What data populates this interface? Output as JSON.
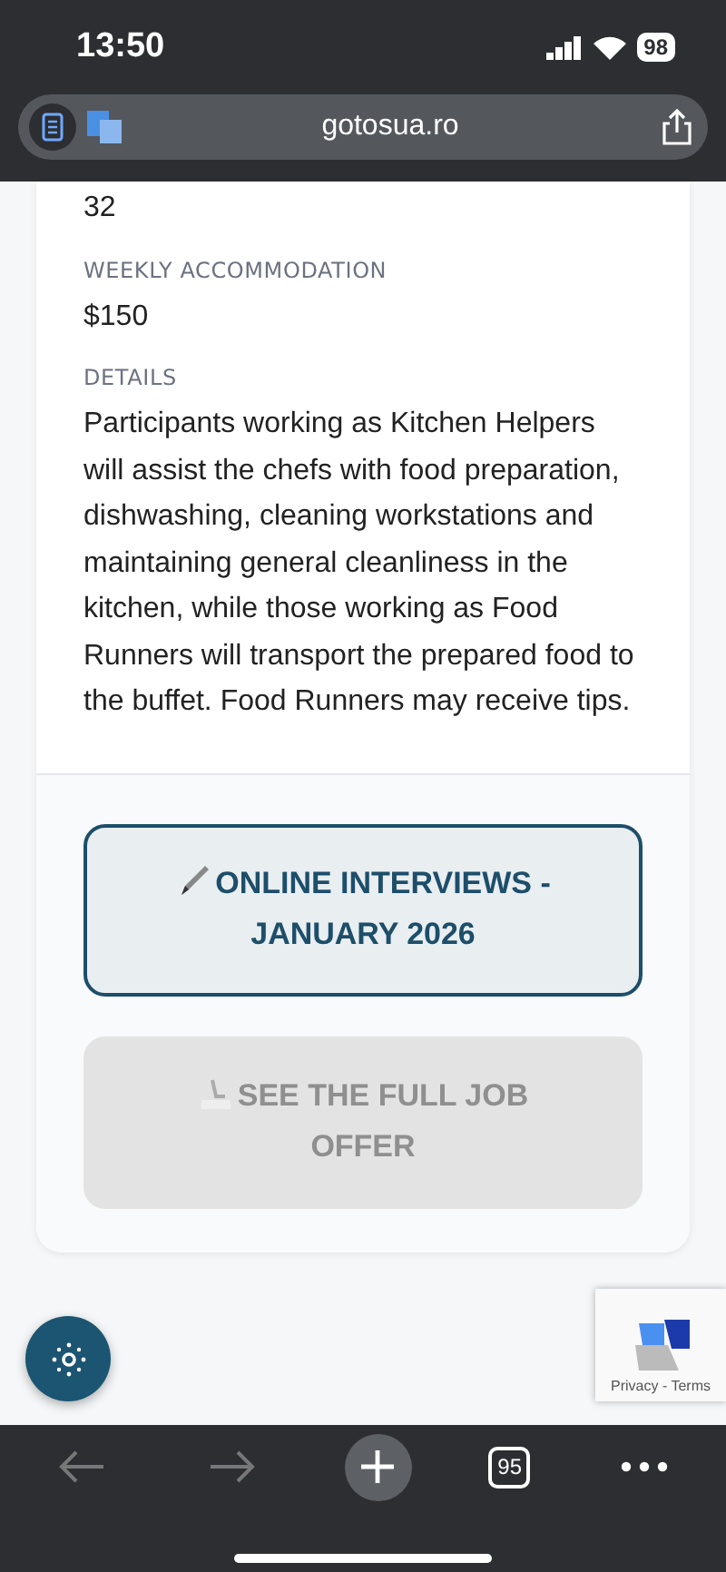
{
  "status_bar": {
    "time": "13:50",
    "battery": "98"
  },
  "address_bar": {
    "url": "gotosua.ro"
  },
  "fields": [
    {
      "value": "32"
    },
    {
      "label": "WEEKLY ACCOMMODATION",
      "value": "$150"
    },
    {
      "label": "DETAILS",
      "value": "Participants working as Kitchen Helpers will assist the chefs with food preparation, dishwashing, cleaning workstations and maintaining general cleanliness in the kitchen, while those working as Food Runners will transport the prepared food to the buffet. Food Runners may receive tips."
    }
  ],
  "buttons": [
    {
      "kind": "pen",
      "label": "ONLINE INTERVIEWS - JANUARY 2026",
      "disabled": false
    },
    {
      "kind": "seat",
      "label": "SEE THE FULL JOB OFFER",
      "disabled": true
    }
  ],
  "recaptcha": {
    "links": "Privacy - Terms"
  },
  "toolbar": {
    "tab_count": "95"
  }
}
